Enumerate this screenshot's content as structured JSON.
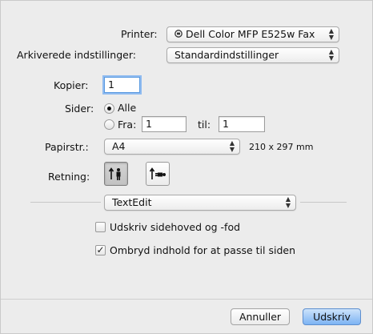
{
  "printer": {
    "label": "Printer:",
    "value": "Dell Color MFP E525w Fax",
    "icon": "printer-icon"
  },
  "presets": {
    "label": "Arkiverede indstillinger:",
    "value": "Standardindstillinger"
  },
  "copies": {
    "label": "Kopier:",
    "value": "1"
  },
  "pages": {
    "label": "Sider:",
    "all_label": "Alle",
    "all_selected": true,
    "from_label": "Fra:",
    "from_value": "1",
    "to_label": "til:",
    "to_value": "1"
  },
  "paper_size": {
    "label": "Papirstr.:",
    "value": "A4",
    "dimensions": "210 x 297 mm"
  },
  "orientation": {
    "label": "Retning:",
    "selected": "portrait",
    "icons": [
      "portrait-orientation-icon",
      "landscape-orientation-icon"
    ]
  },
  "app_section": {
    "value": "TextEdit"
  },
  "options": {
    "header_footer": {
      "label": "Udskriv sidehoved og -fod",
      "checked": false
    },
    "rewrap": {
      "label": "Ombryd indhold for at passe til siden",
      "checked": true
    }
  },
  "buttons": {
    "cancel": "Annuller",
    "print": "Udskriv"
  },
  "colors": {
    "accent": "#5a9ae0",
    "default_button": "#7db3f3",
    "background": "#ececec"
  }
}
